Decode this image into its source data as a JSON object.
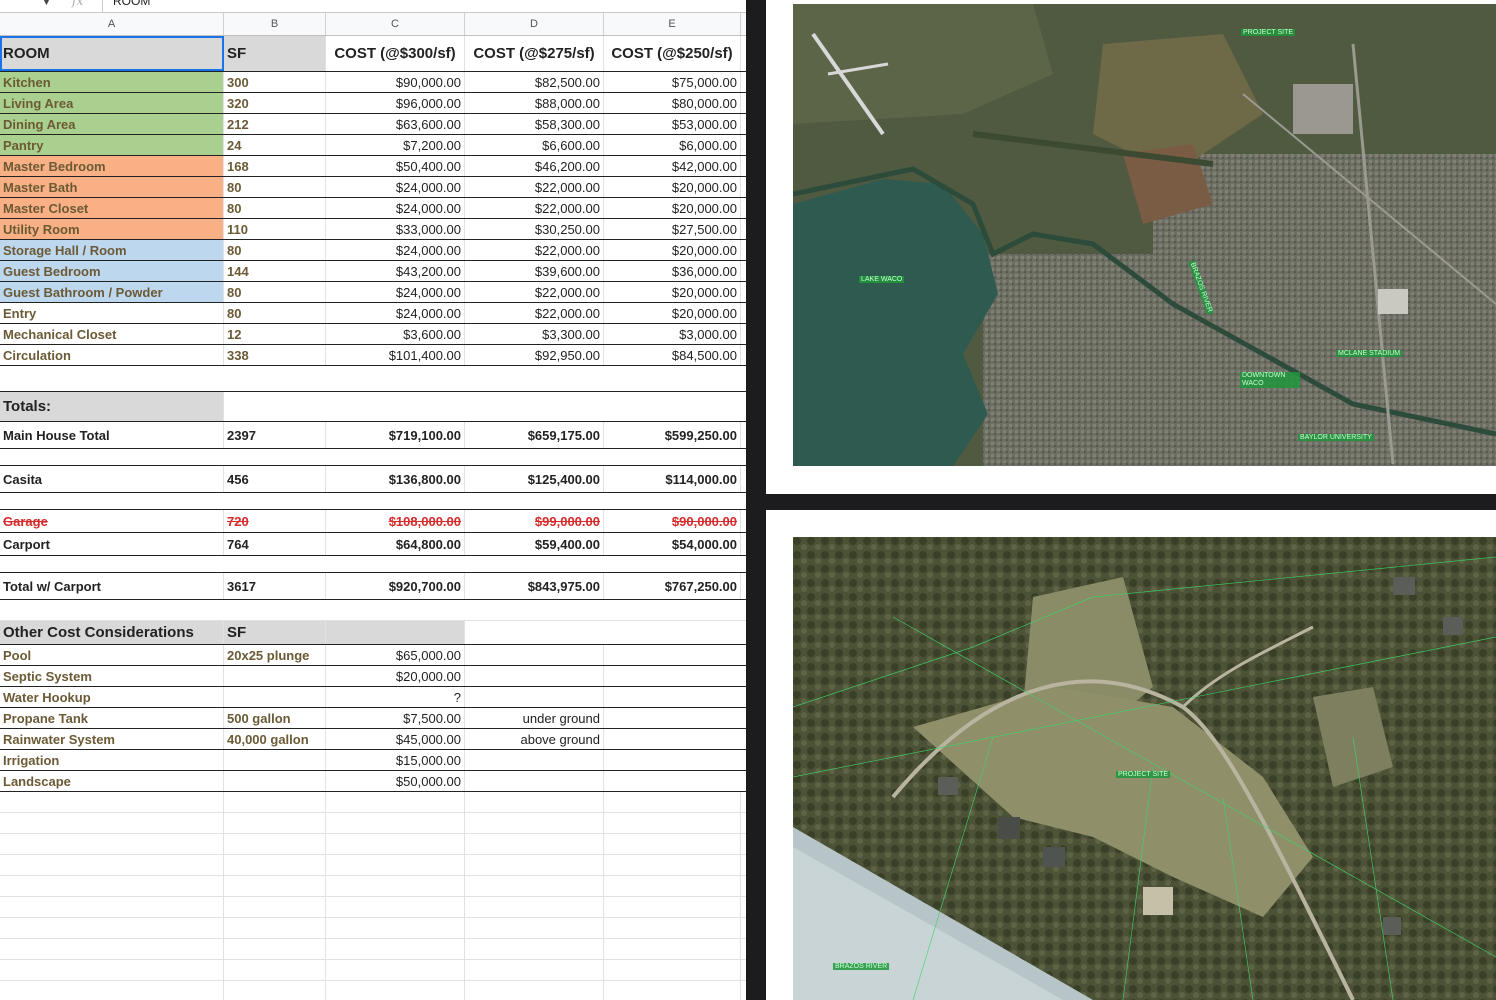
{
  "formula_bar": {
    "value": "ROOM",
    "fx": "fx"
  },
  "columns": [
    "A",
    "B",
    "C",
    "D",
    "E"
  ],
  "header": {
    "room": "ROOM",
    "sf": "SF",
    "c300": "COST (@$300/sf)",
    "c275": "COST (@$275/sf)",
    "c250": "COST (@$250/sf)"
  },
  "rooms": [
    {
      "name": "Kitchen",
      "sf": "300",
      "c300": "$90,000.00",
      "c275": "$82,500.00",
      "c250": "$75,000.00",
      "fill": "green"
    },
    {
      "name": "Living Area",
      "sf": "320",
      "c300": "$96,000.00",
      "c275": "$88,000.00",
      "c250": "$80,000.00",
      "fill": "green"
    },
    {
      "name": "Dining Area",
      "sf": "212",
      "c300": "$63,600.00",
      "c275": "$58,300.00",
      "c250": "$53,000.00",
      "fill": "green"
    },
    {
      "name": "Pantry",
      "sf": "24",
      "c300": "$7,200.00",
      "c275": "$6,600.00",
      "c250": "$6,000.00",
      "fill": "green"
    },
    {
      "name": "Master Bedroom",
      "sf": "168",
      "c300": "$50,400.00",
      "c275": "$46,200.00",
      "c250": "$42,000.00",
      "fill": "orange"
    },
    {
      "name": "Master Bath",
      "sf": "80",
      "c300": "$24,000.00",
      "c275": "$22,000.00",
      "c250": "$20,000.00",
      "fill": "orange"
    },
    {
      "name": "Master Closet",
      "sf": "80",
      "c300": "$24,000.00",
      "c275": "$22,000.00",
      "c250": "$20,000.00",
      "fill": "orange"
    },
    {
      "name": "Utility Room",
      "sf": "110",
      "c300": "$33,000.00",
      "c275": "$30,250.00",
      "c250": "$27,500.00",
      "fill": "orange"
    },
    {
      "name": "Storage Hall / Room",
      "sf": "80",
      "c300": "$24,000.00",
      "c275": "$22,000.00",
      "c250": "$20,000.00",
      "fill": "blue"
    },
    {
      "name": "Guest Bedroom",
      "sf": "144",
      "c300": "$43,200.00",
      "c275": "$39,600.00",
      "c250": "$36,000.00",
      "fill": "blue"
    },
    {
      "name": "Guest Bathroom / Powder",
      "sf": "80",
      "c300": "$24,000.00",
      "c275": "$22,000.00",
      "c250": "$20,000.00",
      "fill": "blue"
    },
    {
      "name": "Entry",
      "sf": "80",
      "c300": "$24,000.00",
      "c275": "$22,000.00",
      "c250": "$20,000.00",
      "fill": "none"
    },
    {
      "name": "Mechanical Closet",
      "sf": "12",
      "c300": "$3,600.00",
      "c275": "$3,300.00",
      "c250": "$3,000.00",
      "fill": "none"
    },
    {
      "name": "Circulation",
      "sf": "338",
      "c300": "$101,400.00",
      "c275": "$92,950.00",
      "c250": "$84,500.00",
      "fill": "none"
    }
  ],
  "totals_label": "Totals:",
  "totals": {
    "main": {
      "name": "Main House Total",
      "sf": "2397",
      "c300": "$719,100.00",
      "c275": "$659,175.00",
      "c250": "$599,250.00"
    },
    "casita": {
      "name": "Casita",
      "sf": "456",
      "c300": "$136,800.00",
      "c275": "$125,400.00",
      "c250": "$114,000.00"
    },
    "garage": {
      "name": "Garage",
      "sf": "720",
      "c300": "$108,000.00",
      "c275": "$99,000.00",
      "c250": "$90,000.00"
    },
    "carport": {
      "name": "Carport",
      "sf": "764",
      "c300": "$64,800.00",
      "c275": "$59,400.00",
      "c250": "$54,000.00"
    },
    "total": {
      "name": "Total w/ Carport",
      "sf": "3617",
      "c300": "$920,700.00",
      "c275": "$843,975.00",
      "c250": "$767,250.00"
    }
  },
  "other": {
    "header": "Other Cost Considerations",
    "sf_header": "SF",
    "items": [
      {
        "name": "Pool",
        "sf": "20x25 plunge",
        "cost": "$65,000.00",
        "note": ""
      },
      {
        "name": "Septic System",
        "sf": "",
        "cost": "$20,000.00",
        "note": ""
      },
      {
        "name": "Water Hookup",
        "sf": "",
        "cost": "?",
        "note": ""
      },
      {
        "name": "Propane Tank",
        "sf": "500 gallon",
        "cost": "$7,500.00",
        "note": "under ground"
      },
      {
        "name": "Rainwater System",
        "sf": "40,000 gallon",
        "cost": "$45,000.00",
        "note": "above ground"
      },
      {
        "name": "Irrigation",
        "sf": "",
        "cost": "$15,000.00",
        "note": ""
      },
      {
        "name": "Landscape",
        "sf": "",
        "cost": "$50,000.00",
        "note": ""
      }
    ]
  },
  "map_top_labels": [
    "PROJECT SITE",
    "LAKE WACO",
    "BRAZOS RIVER",
    "MCLANE STADIUM",
    "DOWNTOWN WACO",
    "BAYLOR UNIVERSITY"
  ],
  "map_bottom_labels": [
    "PROJECT SITE",
    "BRAZOS RIVER"
  ],
  "colors": {
    "green": "#a9d08e",
    "orange": "#f8b084",
    "blue": "#bdd7ee",
    "gray": "#d9d9d9",
    "strike": "#d62b2b",
    "selection": "#1a73e8"
  }
}
